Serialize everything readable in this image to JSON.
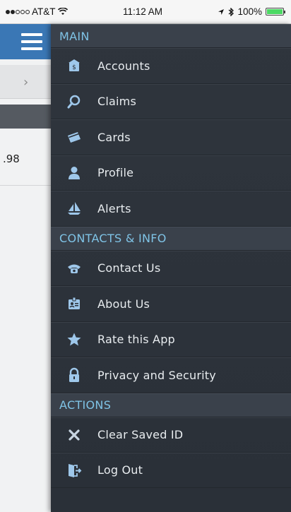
{
  "status_bar": {
    "carrier": "AT&T",
    "time": "11:12 AM",
    "battery": "100%",
    "battery_level": 1.0
  },
  "background_app": {
    "amount_fragment": ".98"
  },
  "menu": {
    "sections": [
      {
        "title": "MAIN",
        "items": [
          {
            "label": "Accounts",
            "icon": "bank-icon"
          },
          {
            "label": "Claims",
            "icon": "magnifier-icon"
          },
          {
            "label": "Cards",
            "icon": "card-icon"
          },
          {
            "label": "Profile",
            "icon": "person-icon"
          },
          {
            "label": "Alerts",
            "icon": "sailboat-icon"
          }
        ]
      },
      {
        "title": "CONTACTS & INFO",
        "items": [
          {
            "label": "Contact Us",
            "icon": "phone-icon"
          },
          {
            "label": "About Us",
            "icon": "id-card-icon"
          },
          {
            "label": "Rate this App",
            "icon": "star-icon"
          },
          {
            "label": "Privacy and Security",
            "icon": "lock-icon"
          }
        ]
      },
      {
        "title": "ACTIONS",
        "items": [
          {
            "label": "Clear Saved ID",
            "icon": "x-icon"
          },
          {
            "label": "Log Out",
            "icon": "logout-icon"
          }
        ]
      }
    ]
  },
  "colors": {
    "icon_blue": "#9ec7ea",
    "section_text": "#7fc3e6",
    "header_blue": "#3a77b5"
  }
}
